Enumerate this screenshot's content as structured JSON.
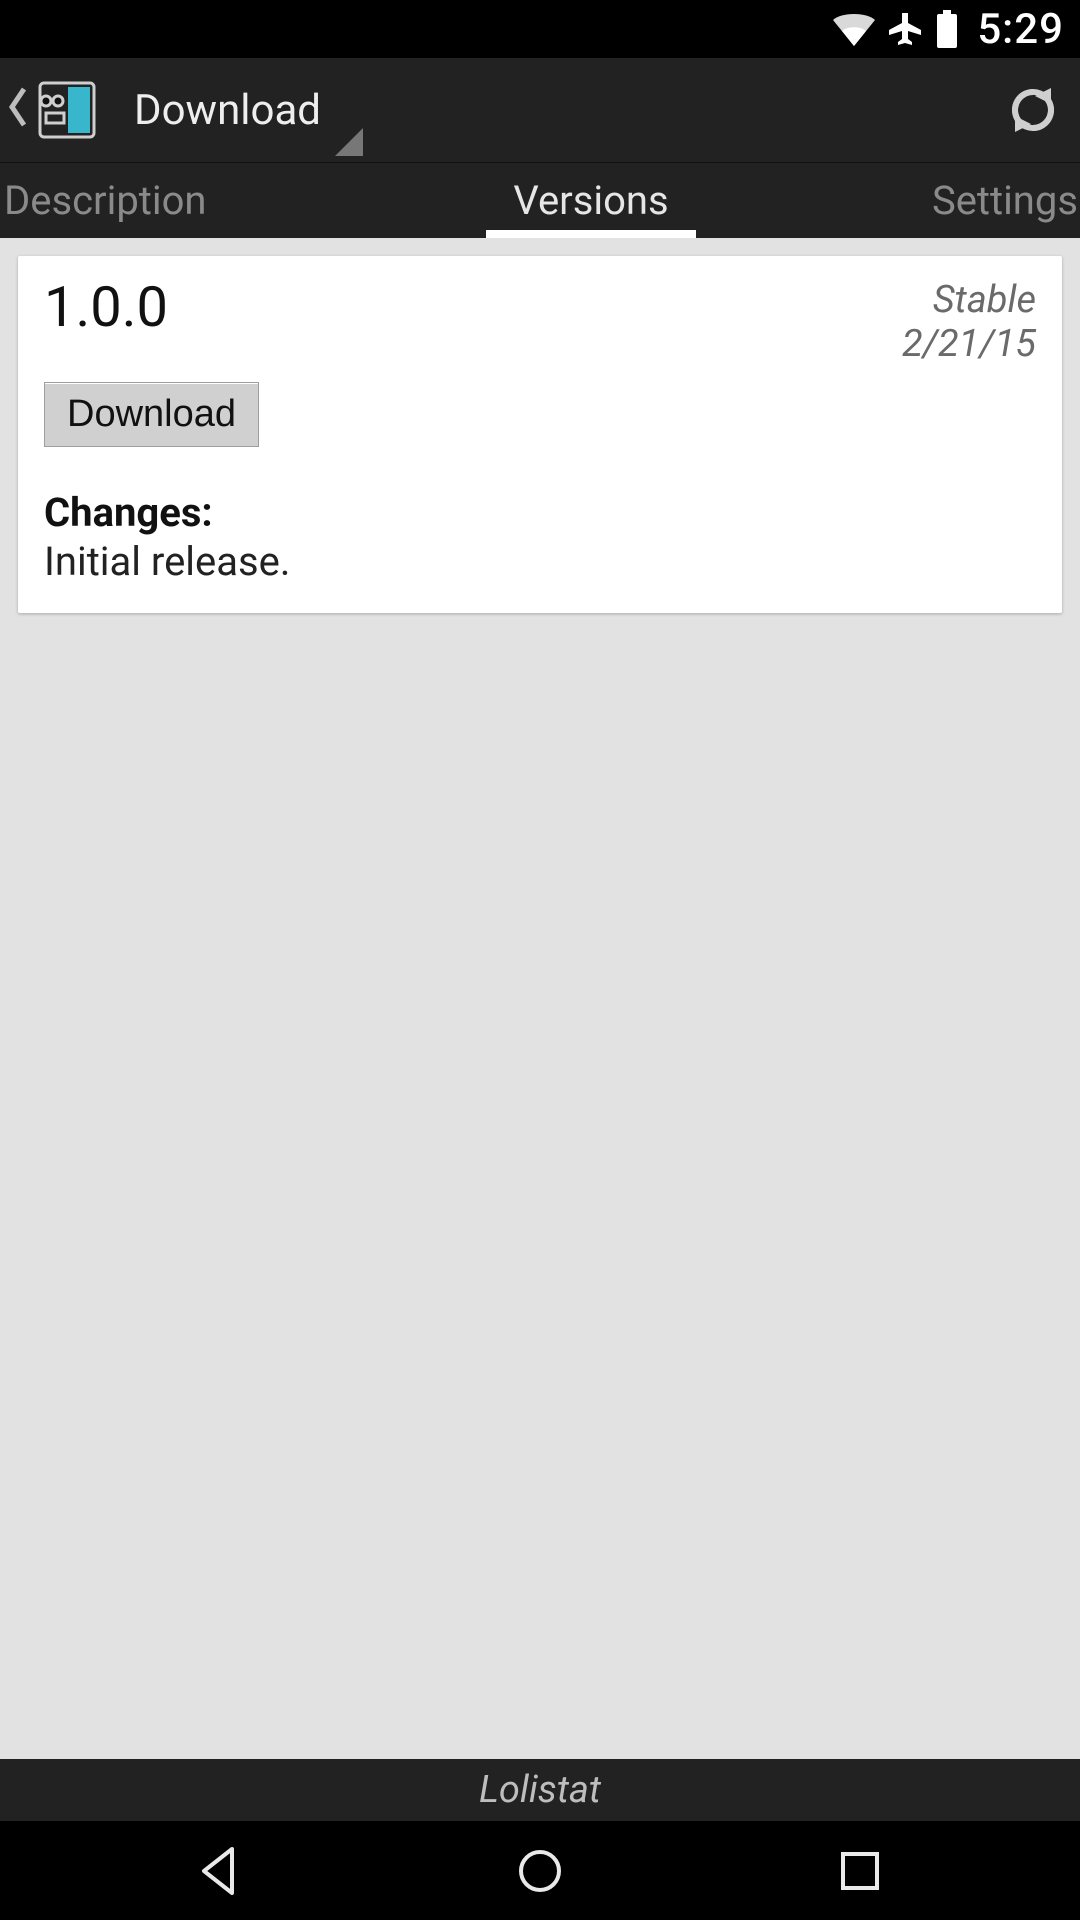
{
  "status": {
    "time": "5:29",
    "icons": {
      "wifi": "wifi-icon",
      "airplane": "airplane-icon",
      "battery": "battery-icon"
    },
    "colors": {
      "icon": "#ffffff",
      "lighter": "#cfcfcf"
    }
  },
  "action_bar": {
    "title": "Download",
    "icons": {
      "app": "xposed-app-icon",
      "refresh": "refresh-icon",
      "back": "back-chevron-icon"
    },
    "colors": {
      "bg": "#222222",
      "title": "#eeeeee",
      "accent": "#38c3d8"
    }
  },
  "tabs": {
    "items": [
      {
        "label": "Description",
        "active": false
      },
      {
        "label": "Versions",
        "active": true
      },
      {
        "label": "Settings",
        "active": false
      }
    ]
  },
  "versions": [
    {
      "number": "1.0.0",
      "stability": "Stable",
      "date": "2/21/15",
      "download_label": "Download",
      "changes_label": "Changes:",
      "changes_text": "Initial release."
    }
  ],
  "footer": {
    "title": "Lolistat"
  },
  "nav": {
    "icons": {
      "back": "nav-back-icon",
      "home": "nav-home-icon",
      "recent": "nav-recent-icon"
    }
  },
  "colors": {
    "page_bg": "#e2e2e2",
    "card_bg": "#ffffff",
    "muted": "#6a6a6a",
    "divider": "#9e9e9e"
  }
}
